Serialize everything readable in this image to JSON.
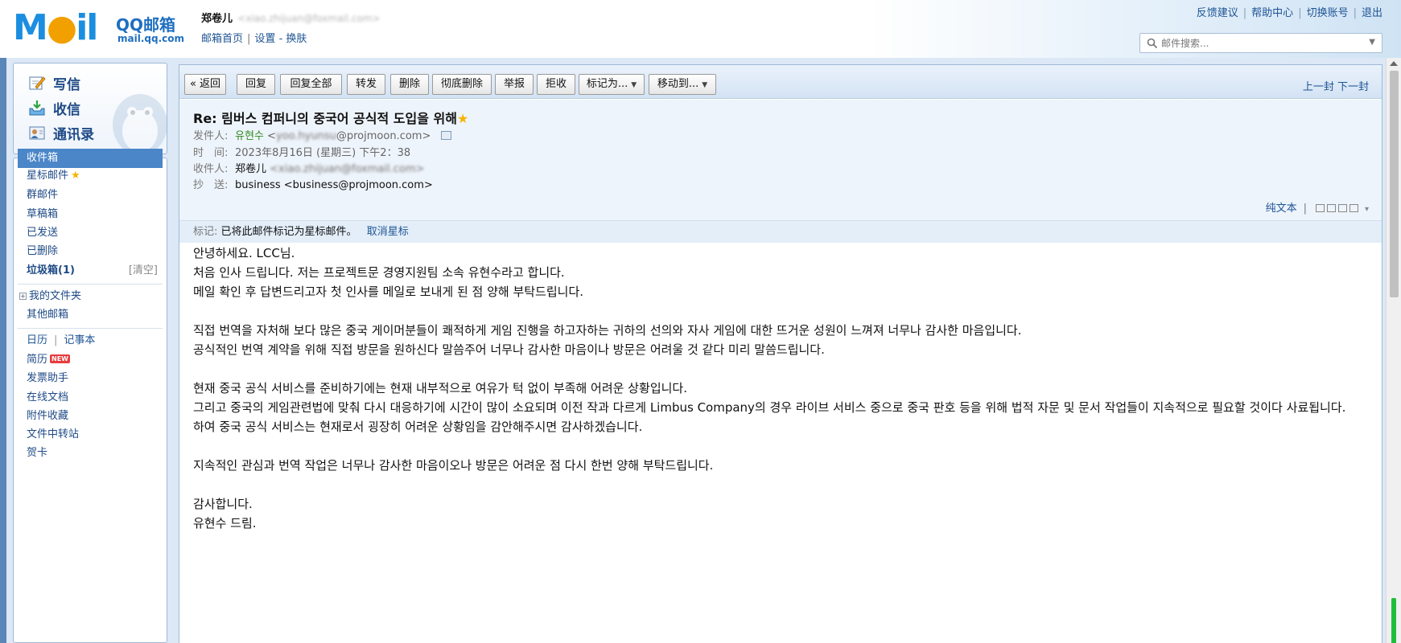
{
  "app": {
    "logo_text": "M",
    "logo_bell": "●",
    "logo_tail": "il",
    "brand": "QQ邮箱",
    "domain": "mail.qq.com"
  },
  "account": {
    "name": "郑卷儿",
    "email_blurred": "<xiao.zhijuan@foxmail.com>",
    "home_link": "邮箱首页",
    "settings_link": "设置",
    "dash": "-",
    "skin_link": "换肤"
  },
  "top_links": [
    "反馈建议",
    "帮助中心",
    "切换账号",
    "退出"
  ],
  "search": {
    "placeholder": "邮件搜索..."
  },
  "sidebar": {
    "compose": "写信",
    "inbox": "收信",
    "contacts": "通讯录",
    "folders": {
      "inbox": "收件箱",
      "starred": "星标邮件",
      "group": "群邮件",
      "drafts": "草稿箱",
      "sent": "已发送",
      "deleted": "已删除",
      "junk": "垃圾箱(1)",
      "junk_clear": "[清空]",
      "my_folders": "我的文件夹",
      "other_mailboxes": "其他邮箱",
      "calendar": "日历",
      "notes": "记事本",
      "resume": "简历",
      "resume_badge": "NEW",
      "invoice": "发票助手",
      "docs": "在线文档",
      "attachments": "附件收藏",
      "transfer": "文件中转站",
      "cards": "贺卡"
    }
  },
  "toolbar": {
    "back": "« 返回",
    "reply": "回复",
    "reply_all": "回复全部",
    "forward": "转发",
    "delete": "删除",
    "delete_perm": "彻底删除",
    "report": "举报",
    "reject": "拒收",
    "mark_as": "标记为...",
    "move_to": "移动到...",
    "prev": "上一封",
    "next": "下一封"
  },
  "mail": {
    "subject": "Re: 림버스 컴퍼니의 중국어 공식적 도입을 위해",
    "from_label": "发件人:",
    "from_name": "유현수",
    "from_lt": "<",
    "from_user_blurred": "yoo.hyunsu",
    "from_domain": "@projmoon.com>",
    "time_label": "时　间:",
    "time_value": "2023年8月16日 (星期三) 下午2：38",
    "to_label": "收件人:",
    "to_name": "郑卷儿",
    "to_email_blurred": "<xiao.zhijuan@foxmail.com>",
    "cc_label": "抄　送:",
    "cc_value": "business <business@projmoon.com>",
    "plain_text": "纯文本",
    "flag_label": "标记:",
    "flag_text": "已将此邮件标记为星标邮件。",
    "unstar": "取消星标"
  },
  "body": {
    "p1": [
      "안녕하세요. LCC님.",
      "처음 인사 드립니다. 저는 프로젝트문 경영지원팀 소속 유현수라고 합니다.",
      "메일 확인 후 답변드리고자 첫 인사를 메일로 보내게 된 점 양해 부탁드립니다."
    ],
    "p2": [
      "직접 번역을 자처해 보다 많은 중국 게이머분들이 쾌적하게 게임 진행을 하고자하는 귀하의 선의와 자사 게임에 대한 뜨거운 성원이 느껴져 너무나 감사한 마음입니다.",
      "공식적인 번역 계약을 위해 직접 방문을 원하신다 말씀주어 너무나 감사한 마음이나 방문은 어려울 것 같다 미리 말씀드립니다."
    ],
    "p3": [
      "현재 중국 공식 서비스를 준비하기에는 현재 내부적으로 여유가 턱 없이 부족해 어려운 상황입니다.",
      "그리고 중국의 게임관련법에 맞춰 다시 대응하기에 시간이 많이 소요되며 이전 작과 다르게 Limbus Company의 경우 라이브 서비스 중으로 중국 판호 등을 위해 법적 자문 및 문서 작업들이 지속적으로 필요할 것이다 사료됩니다.",
      "하여 중국 공식 서비스는 현재로서 굉장히 어려운 상황임을 감안해주시면 감사하겠습니다."
    ],
    "p4": [
      "지속적인 관심과 번역 작업은 너무나 감사한 마음이오나 방문은 어려운 점 다시 한번 양해 부탁드립니다."
    ],
    "p5": [
      "감사합니다.",
      "유현수 드림."
    ]
  },
  "colors": {
    "accent": "#4a86c8",
    "link": "#1e5494",
    "frame": "#5b86b8",
    "sender_green": "#2e8b1e",
    "star": "#f5b400"
  }
}
